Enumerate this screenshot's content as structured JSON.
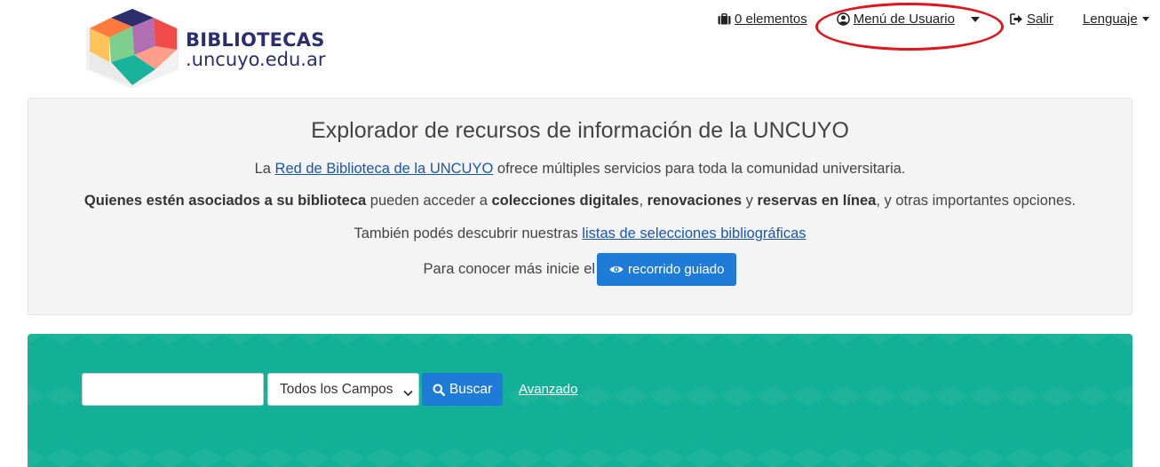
{
  "header": {
    "logo": {
      "title": "BIBLIOTECAS",
      "subtitle": ".uncuyo.edu.ar"
    },
    "nav": {
      "cart_label": "0 elementos",
      "user_menu_label": "Menú de Usuario",
      "logout_label": "Salir",
      "language_label": "Lenguaje"
    }
  },
  "intro": {
    "title": "Explorador de recursos de información de la UNCUYO",
    "p1": {
      "before": "La ",
      "link": "Red de Biblioteca de la UNCUYO",
      "after": " ofrece múltiples servicios para toda la comunidad universitaria."
    },
    "p2": {
      "b1": "Quienes estén asociados a su biblioteca",
      "t1": " pueden acceder a ",
      "b2": "colecciones digitales",
      "t2": ", ",
      "b3": "renovaciones",
      "t3": " y ",
      "b4": "reservas en línea",
      "t4": ", y otras importantes opciones."
    },
    "p3": {
      "before": "También podés descubrir nuestras ",
      "link": "listas de selecciones bibliográficas"
    },
    "p4": {
      "before": "Para conocer más inicie el",
      "button": "recorrido guiado"
    }
  },
  "search": {
    "query_value": "",
    "field_selected": "Todos los Campos",
    "button_label": "Buscar",
    "advanced_label": "Avanzado"
  },
  "colors": {
    "search_band": "#12b096",
    "primary_button": "#1f7bd8",
    "link": "#1a56b0",
    "annotation": "#e3141b"
  }
}
